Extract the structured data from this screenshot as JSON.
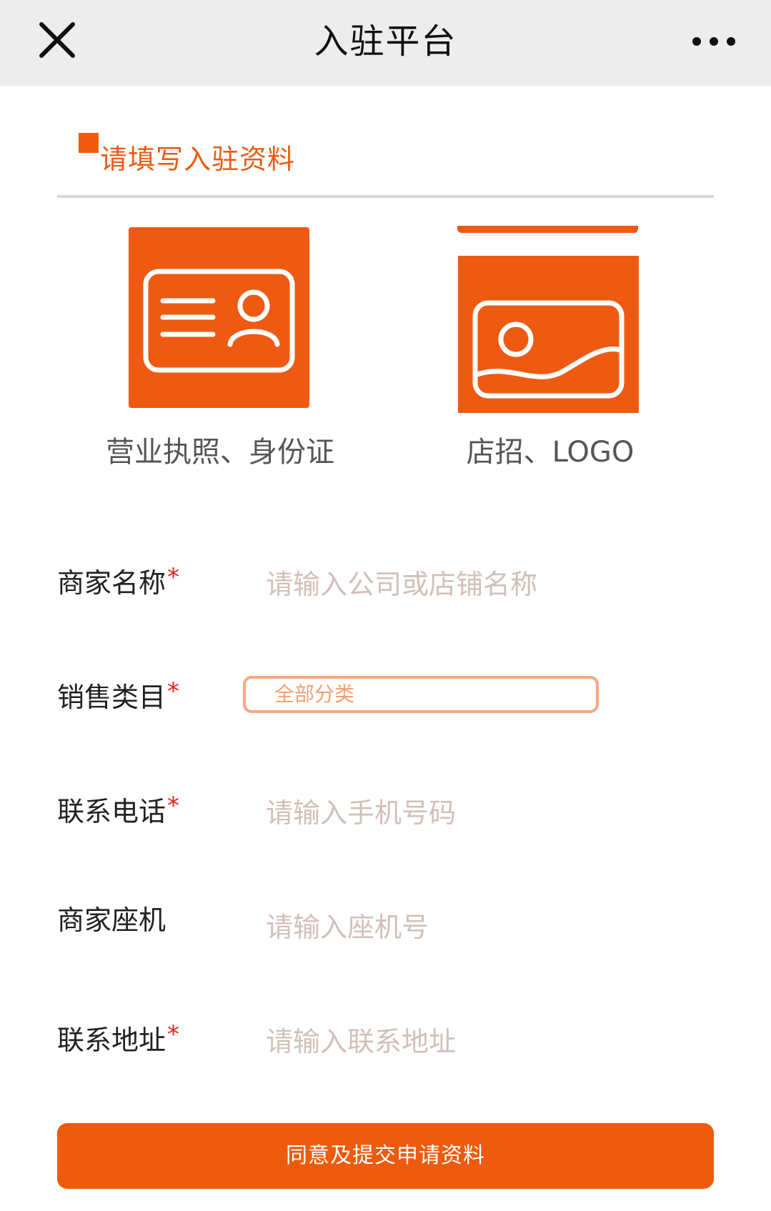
{
  "nav": {
    "title": "入驻平台",
    "close_icon": "close-icon",
    "more_icon": "more-dots-icon"
  },
  "section": {
    "title": "请填写入驻资料"
  },
  "uploads": [
    {
      "label": "营业执照、身份证",
      "icon": "id-card-icon"
    },
    {
      "label": "店招、LOGO",
      "icon": "image-icon"
    }
  ],
  "form": {
    "merchant_name": {
      "label": "商家名称",
      "required_mark": "*",
      "placeholder": "请输入公司或店铺名称"
    },
    "category": {
      "label": "销售类目",
      "required_mark": "*",
      "value": "全部分类"
    },
    "phone": {
      "label": "联系电话",
      "required_mark": "*",
      "placeholder": "请输入手机号码"
    },
    "landline": {
      "label": "商家座机",
      "placeholder": "请输入座机号"
    },
    "address": {
      "label": "联系地址",
      "required_mark": "*",
      "placeholder": "请输入联系地址"
    }
  },
  "submit": {
    "label": "同意及提交申请资料"
  },
  "colors": {
    "accent": "#ee5a12",
    "required": "#e1251b",
    "placeholder": "#d2c0b8",
    "navbar_bg": "#ededed"
  }
}
